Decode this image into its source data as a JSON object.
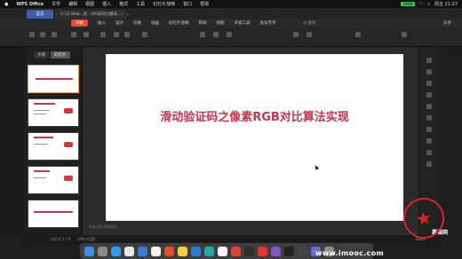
{
  "menubar": {
    "app": "WPS Office",
    "items": [
      "文件",
      "编辑",
      "视图",
      "插入",
      "格式",
      "工具",
      "幻灯片放映",
      "窗口",
      "帮助"
    ],
    "battery": "100%",
    "time": "周五 21:27"
  },
  "tabs": {
    "home": "首页",
    "doc": "5-13 Web...武...(RGB对比算法...)"
  },
  "ribbon": {
    "tabs": [
      "开始",
      "插入",
      "设计",
      "切换",
      "动画",
      "幻灯片放映",
      "审阅",
      "视图",
      "开发工具",
      "会员专享"
    ],
    "active": "开始",
    "search": "Q 查找",
    "share": "分享"
  },
  "panel": {
    "tab_outline": "大纲",
    "tab_slides": "幻灯片"
  },
  "slide": {
    "title": "滑动验证码之像素RGB对比算法实现"
  },
  "notes": "单击此处添加备注",
  "status": {
    "left": "幻灯片 1 / 9",
    "theme": "Office主题",
    "zoom": "100%"
  },
  "watermark": {
    "text": "www.imooc.com",
    "brand": "慕课网"
  },
  "colors": {
    "title_red": "#c8334f",
    "accent_orange": "#e34c2c",
    "tab_blue": "#3c5fa8"
  }
}
